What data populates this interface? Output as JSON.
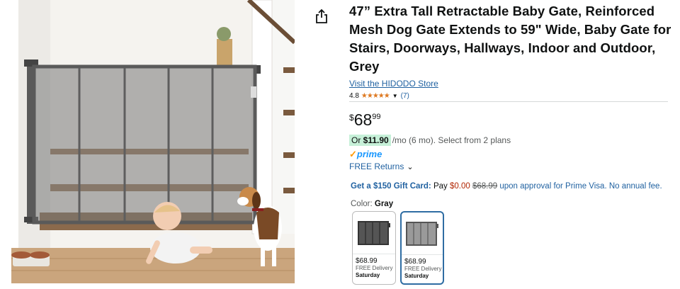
{
  "product": {
    "title": "47” Extra Tall Retractable Baby Gate, Reinforced Mesh Dog Gate Extends to 59\" Wide, Baby Gate for Stairs, Doorways, Hallways, Indoor and Outdoor, Grey",
    "store_link": "Visit the HIDODO Store",
    "rating_value": "4.8",
    "stars": "★★★★★",
    "rating_count": "(7)"
  },
  "price": {
    "symbol": "$",
    "whole": "68",
    "fraction": "99"
  },
  "monthly": {
    "prefix": "Or ",
    "amount": "$11.90",
    "suffix": "/mo (6 mo). Select from 2 plans"
  },
  "prime": {
    "check": "✓",
    "label": "prime",
    "returns": "FREE Returns"
  },
  "gift": {
    "headline": "Get a $150 Gift Card:",
    "pay": " Pay ",
    "pay_amount": "$0.00",
    "original": "$68.99",
    "tail": " upon approval for Prime Visa. No annual fee."
  },
  "color": {
    "label": "Color: ",
    "selected": "Gray"
  },
  "swatches": [
    {
      "price": "$68.99",
      "delivery": "FREE Delivery",
      "day": "Saturday",
      "gate_color": "#555555"
    },
    {
      "price": "$68.99",
      "delivery": "FREE Delivery",
      "day": "Saturday",
      "gate_color": "#9a9a9a"
    }
  ],
  "colors": {
    "link": "#2162a1",
    "accent_border": "#2f6da3",
    "deal_highlight": "#c6f0d8",
    "prime_blue": "#1a98ff",
    "star_orange": "#de7921"
  },
  "icons": {
    "share": "share-icon",
    "chevron": "chevron-down-icon"
  }
}
